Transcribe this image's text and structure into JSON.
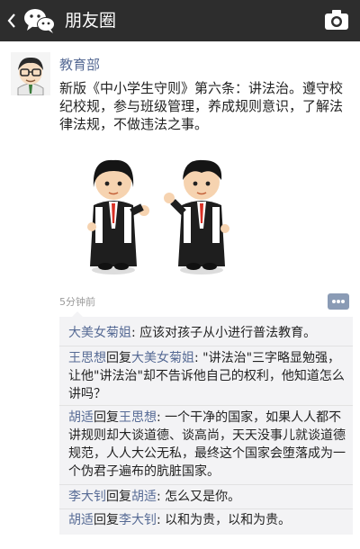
{
  "header": {
    "title": "朋友圈",
    "icons": {
      "back": "back-chevron-icon",
      "logo": "wechat-logo-icon",
      "camera": "camera-icon"
    }
  },
  "post": {
    "author": "教育部",
    "text": "新版《中小学生守则》第六条：讲法治。遵守校纪校规，参与班级管理，养成规则意识，了解法律法规，不做违法之事。",
    "time": "5分钟前"
  },
  "comments": [
    {
      "user": "大美女菊姐",
      "reply_word": "",
      "reply_to": "",
      "text": ": 应该对孩子从小进行普法教育。"
    },
    {
      "user": "王思想",
      "reply_word": "回复",
      "reply_to": "大美女菊姐",
      "text": ": \"讲法治\"三字略显勉强，让他\"讲法治\"却不告诉他自己的权利，他知道怎么讲吗？"
    },
    {
      "user": "胡适",
      "reply_word": "回复",
      "reply_to": "王思想",
      "text": ": 一个干净的国家，如果人人都不讲规则却大谈道德、谈高尚，天天没事儿就谈道德规范，人人大公无私，最终这个国家会堕落成为一个伪君子遍布的肮脏国家。"
    },
    {
      "user": "李大钊",
      "reply_word": "回复",
      "reply_to": "胡适",
      "text": ": 怎么又是你。"
    },
    {
      "user": "胡适",
      "reply_word": "回复",
      "reply_to": "李大钊",
      "text": ": 以和为贵，以和为贵。"
    }
  ]
}
